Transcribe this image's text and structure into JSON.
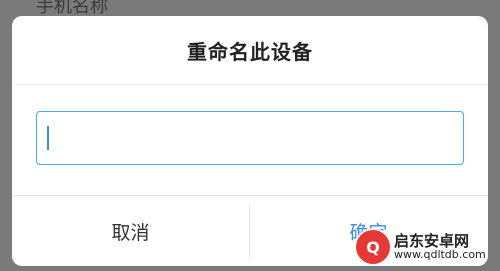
{
  "background": {
    "title": "手机名称"
  },
  "dialog": {
    "title": "重命名此设备",
    "input": {
      "value": "",
      "placeholder": ""
    },
    "cancel_label": "取消",
    "confirm_label": "确定"
  },
  "watermark": {
    "name": "启东安卓网",
    "url": "www.qdltdb.com",
    "logo_glyph": "Q"
  },
  "colors": {
    "accent": "#3a8ee6",
    "input_border": "#4aa7e8",
    "overlay": "#7a7a7a"
  }
}
